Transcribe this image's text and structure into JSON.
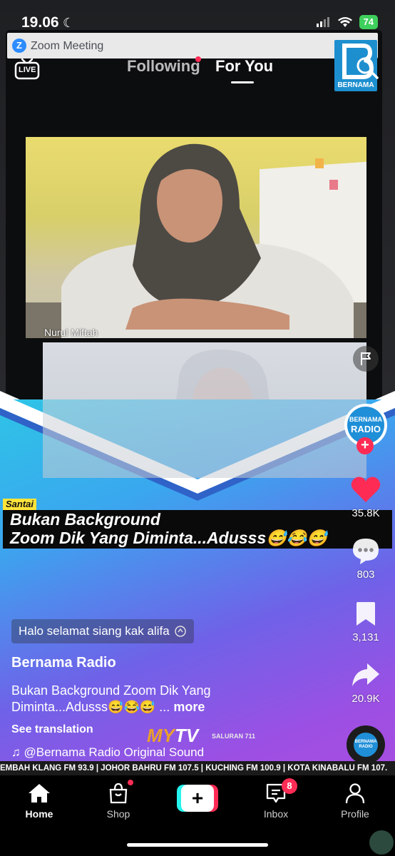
{
  "status_bar": {
    "time": "19.06",
    "battery": "74"
  },
  "top_nav": {
    "live_label": "LIVE",
    "tabs": [
      {
        "label": "Following"
      },
      {
        "label": "For You"
      }
    ],
    "active_tab": "For You"
  },
  "video": {
    "zoom_window_title": "Zoom Meeting",
    "zoom_logo": "Z",
    "participant_name": "Nurul Miftah",
    "watermark_text": "BERNAMA",
    "category_tag": "Santai",
    "headline_line1": "Bukan Background",
    "headline_line2": "Zoom Dik Yang Diminta...Adusss😅😂😅",
    "mytv_my": "MY",
    "mytv_tv": "TV",
    "saluran": "SALURAN 711",
    "ticker": "EMBAH KLANG FM 93.9 | JOHOR BAHRU FM 107.5 | KUCHING FM 100.9 | KOTA KINABALU FM 107."
  },
  "right_rail": {
    "avatar_line1": "BERNAMA",
    "avatar_line2": "RADIO",
    "likes": "35.8K",
    "comments": "803",
    "saves": "3,131",
    "shares": "20.9K",
    "disc_label": "BERNAMA RADIO"
  },
  "post": {
    "comment_chip": "Halo selamat siang kak alifa",
    "author": "Bernama Radio",
    "description": "Bukan Background Zoom Dik Yang Diminta...Adusss😅😂😅 ...",
    "more_label": "more",
    "see_translation": "See translation",
    "sound": "♫ @Bernama Radio Original Sound"
  },
  "bottom_nav": {
    "items": [
      {
        "label": "Home"
      },
      {
        "label": "Shop"
      },
      {
        "label": "Inbox"
      },
      {
        "label": "Profile"
      }
    ],
    "create_label": "+",
    "inbox_badge": "8"
  },
  "colors": {
    "accent": "#fe2c55",
    "cyan": "#25f4ee",
    "bernama_blue": "#1f8fd8"
  }
}
